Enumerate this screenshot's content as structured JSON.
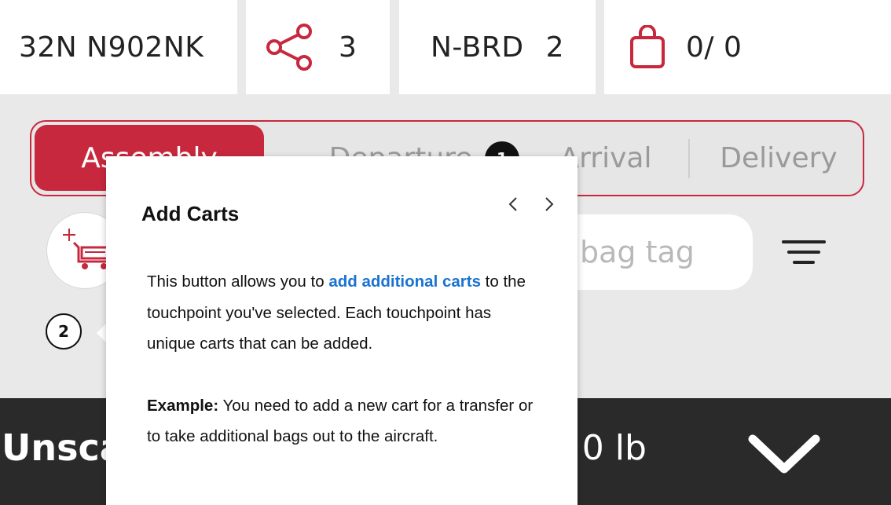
{
  "topbar": {
    "flight": "32N  N902NK",
    "share_count": "3",
    "stand_code": "N-BRD",
    "stand_count": "2",
    "bag_count": "0/ 0"
  },
  "tabs": [
    {
      "label": "Assembly",
      "active": true
    },
    {
      "label": "Departure",
      "active": false
    },
    {
      "label": "Arrival",
      "active": false
    },
    {
      "label": "Delivery",
      "active": false
    }
  ],
  "toolbar": {
    "search_placeholder": "bag tag"
  },
  "steps": {
    "badge1": "1",
    "badge2": "2"
  },
  "bottombar": {
    "unscanned_label": "Unsca",
    "weight": "/ 0 lb"
  },
  "popover": {
    "title": "Add Carts",
    "body_before": "This button allows you to ",
    "body_highlight": "add additional carts",
    "body_after": " to the touchpoint you've selected. Each touchpoint has unique carts that can be added.",
    "example_label": "Example:",
    "example_text": " You need to add a new cart for a transfer or to take additional bags out to the aircraft."
  },
  "colors": {
    "accent": "#c8283d",
    "link": "#1a73d1",
    "bottom_bar": "#2a2a2a",
    "background": "#e9e9e9"
  },
  "icons": [
    "share-icon",
    "bag-icon",
    "add-cart-icon",
    "filter-icon",
    "chevron-down-icon",
    "chevron-left-icon",
    "chevron-right-icon"
  ]
}
